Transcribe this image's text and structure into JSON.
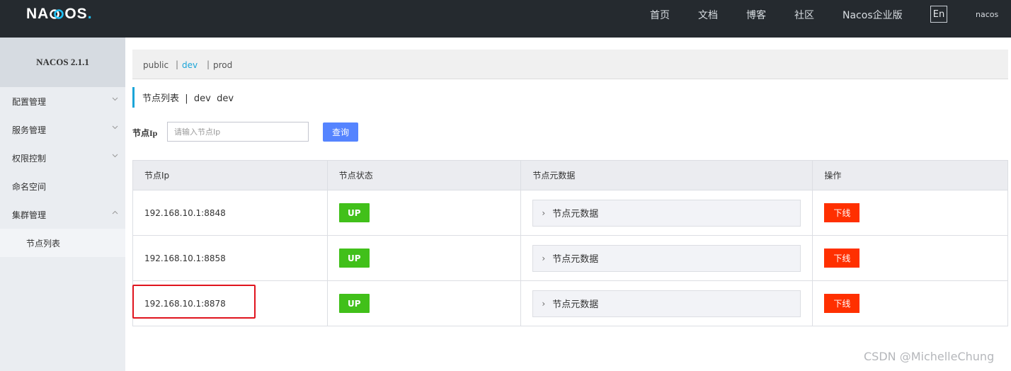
{
  "header": {
    "logo_text": "NACOS",
    "nav": [
      {
        "label": "首页"
      },
      {
        "label": "文档"
      },
      {
        "label": "博客"
      },
      {
        "label": "社区"
      },
      {
        "label": "Nacos企业版"
      }
    ],
    "language_button": "En",
    "user": "nacos"
  },
  "sidebar": {
    "version": "NACOS 2.1.1",
    "items": [
      {
        "label": "配置管理",
        "expanded": false
      },
      {
        "label": "服务管理",
        "expanded": false
      },
      {
        "label": "权限控制",
        "expanded": false
      },
      {
        "label": "命名空间"
      },
      {
        "label": "集群管理",
        "expanded": true
      }
    ],
    "sub_item": "节点列表"
  },
  "namespaces": {
    "items": [
      "public",
      "dev",
      "prod"
    ],
    "active": "dev",
    "separator": "|"
  },
  "page": {
    "title": "节点列表  |  dev  dev"
  },
  "search": {
    "label": "节点Ip",
    "placeholder": "请输入节点Ip",
    "value": "",
    "button": "查询"
  },
  "table": {
    "columns": [
      "节点Ip",
      "节点状态",
      "节点元数据",
      "操作"
    ],
    "rows": [
      {
        "ip": "192.168.10.1:8848",
        "status": "UP",
        "meta": "节点元数据",
        "action": "下线"
      },
      {
        "ip": "192.168.10.1:8858",
        "status": "UP",
        "meta": "节点元数据",
        "action": "下线"
      },
      {
        "ip": "192.168.10.1:8878",
        "status": "UP",
        "meta": "节点元数据",
        "action": "下线"
      }
    ]
  },
  "watermark": "CSDN @MichelleChung",
  "colors": {
    "header_bg": "#252a2f",
    "accent": "#1ba5d8",
    "primary_button": "#5584ff",
    "status_up": "#41c01a",
    "danger": "#ff3000",
    "highlight_box": "#e0141e"
  }
}
